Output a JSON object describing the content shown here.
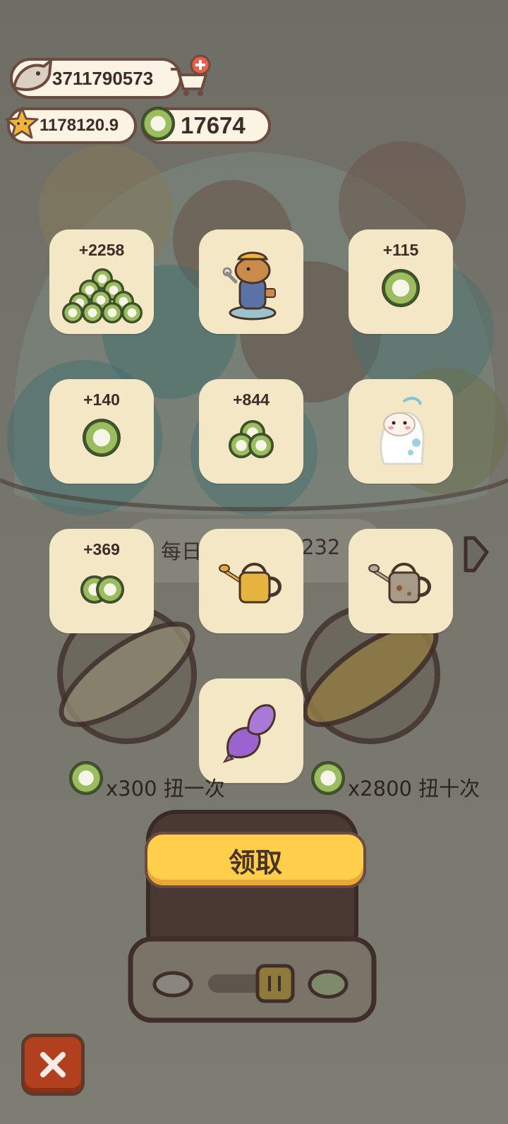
{
  "currencies": {
    "fish": "3711790573",
    "stars": "1178120.9",
    "coins": "17674"
  },
  "banner": {
    "left_text": "每日",
    "right_text": "232"
  },
  "rewards": [
    {
      "amount": "+2258",
      "item": "coin-pile"
    },
    {
      "amount": "",
      "item": "capybara-mechanic"
    },
    {
      "amount": "+115",
      "item": "coin"
    },
    {
      "amount": "+140",
      "item": "coin"
    },
    {
      "amount": "+844",
      "item": "coin-stack"
    },
    {
      "amount": "",
      "item": "frog-sticker"
    },
    {
      "amount": "+369",
      "item": "coins-pair"
    },
    {
      "amount": "",
      "item": "golden-watering-can"
    },
    {
      "amount": "",
      "item": "rusty-watering-can"
    },
    {
      "amount": "",
      "item": "purple-fish"
    }
  ],
  "spin": {
    "single_price": "x300 扭一次",
    "ten_price": "x2800 扭十次"
  },
  "claim_label": "领取",
  "colors": {
    "tile": "#f4e7c6",
    "claim": "#ffcf4b",
    "close": "#b2401f",
    "outline": "#6d4b3e"
  }
}
